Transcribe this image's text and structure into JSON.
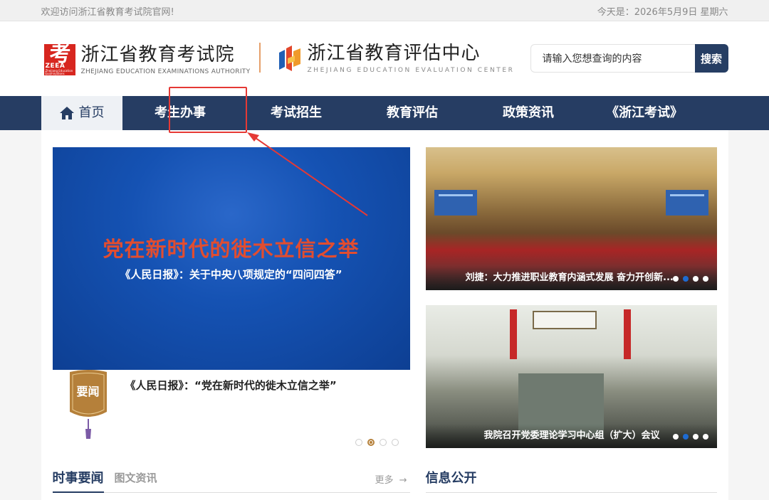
{
  "topbar": {
    "welcome": "欢迎访问浙江省教育考试院官网!",
    "date": "今天是：2026年5月9日 星期六"
  },
  "header": {
    "logo1": {
      "badge_char": "考",
      "badge_abbr": "ZEEA",
      "badge_small": "Zhejiang Education Examinations Authority",
      "name": "浙江省教育考试院",
      "name_en": "ZHEJIANG EDUCATION EXAMINATIONS AUTHORITY"
    },
    "logo2": {
      "name": "浙江省教育评估中心",
      "name_en": "ZHEJIANG EDUCATION EVALUATION CENTER"
    },
    "search": {
      "placeholder": "请输入您想查询的内容",
      "button": "搜索"
    }
  },
  "nav": {
    "items": [
      {
        "label": "首页"
      },
      {
        "label": "考生办事"
      },
      {
        "label": "考试招生"
      },
      {
        "label": "教育评估"
      },
      {
        "label": "政策资讯"
      },
      {
        "label": "《浙江考试》"
      }
    ]
  },
  "hero": {
    "headline": "党在新时代的徙木立信之举",
    "subheadline": "《人民日报》：关于中央八项规定的“四问四答”",
    "caption": "《人民日报》：“党在新时代的徙木立信之举”",
    "badge": "要闻",
    "slide_count": 4,
    "active_slide": 2
  },
  "photos": [
    {
      "caption": "刘捷：大力推进职业教育内涵式发展 奋力开创新...",
      "active_dot": 2,
      "dot_count": 4
    },
    {
      "caption": "我院召开党委理论学习中心组（扩大）会议",
      "active_dot": 2,
      "dot_count": 4
    }
  ],
  "sections": {
    "news": {
      "title": "时事要闻",
      "subtitle": "图文资讯",
      "more": "更多"
    },
    "info": {
      "title": "信息公开"
    }
  },
  "colors": {
    "nav_bg": "#263d63",
    "accent_red": "#e53935",
    "hero_blue": "#1552b3"
  }
}
